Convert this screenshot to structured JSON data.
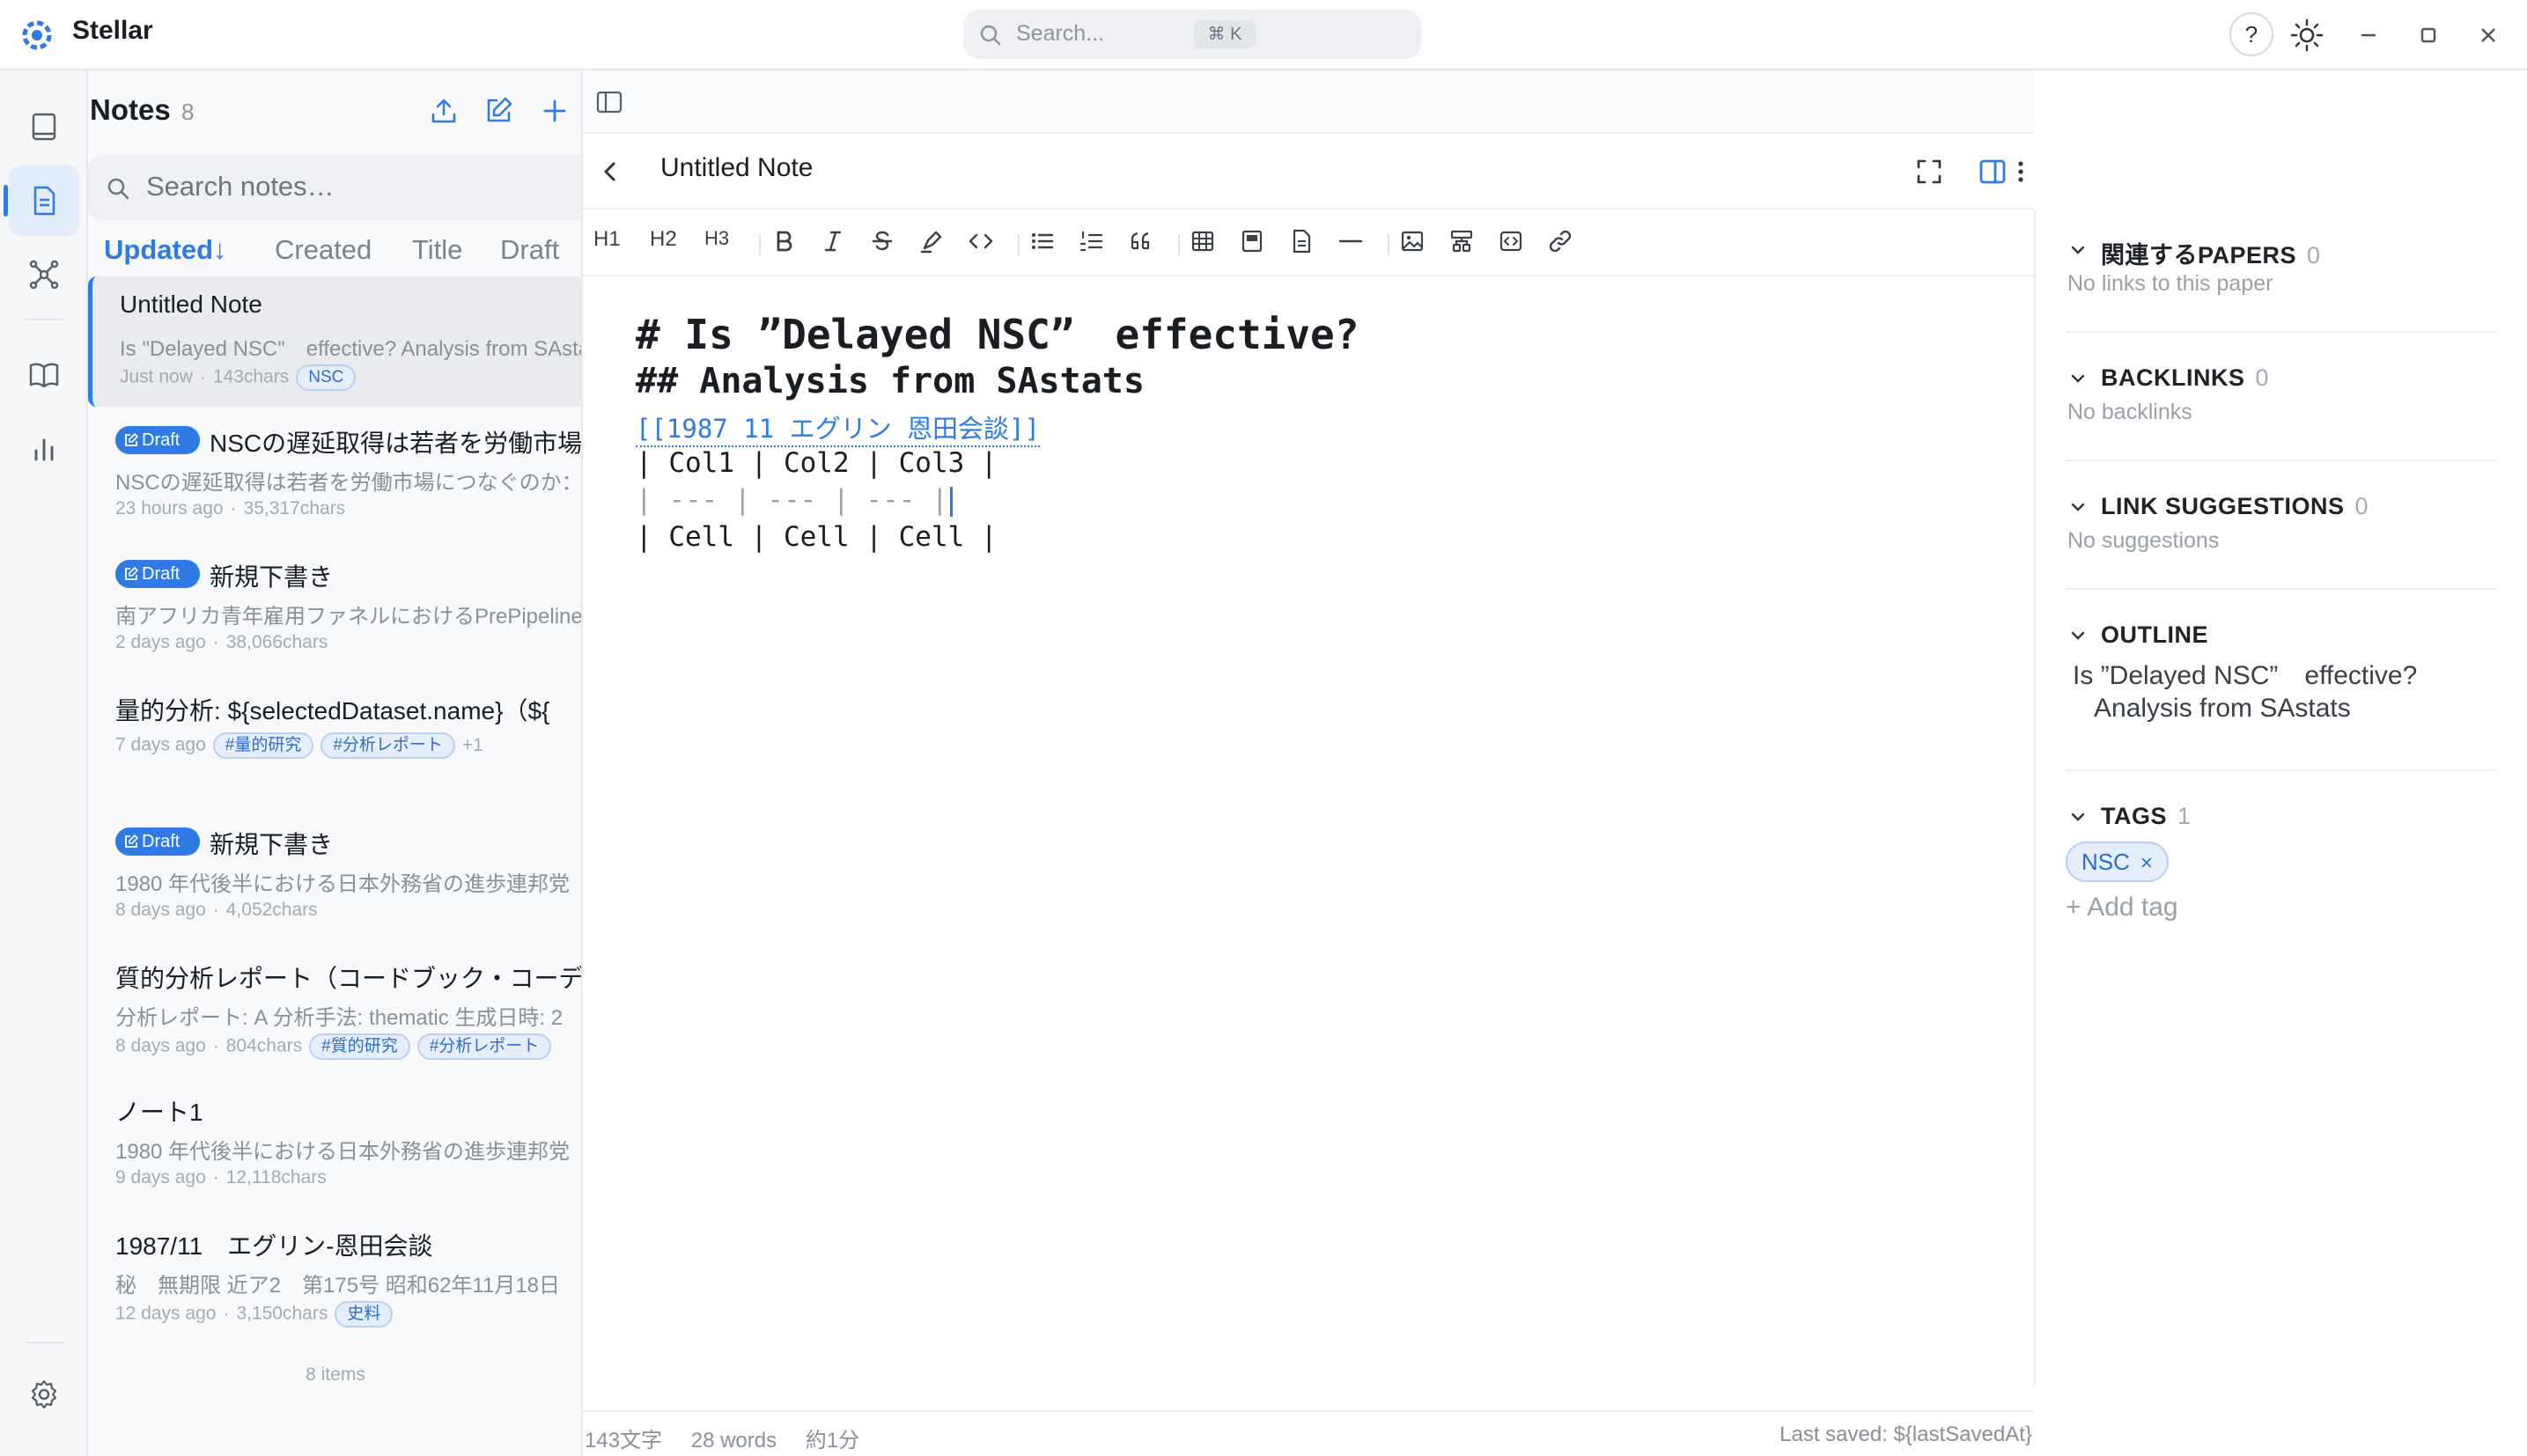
{
  "app": {
    "name": "Stellar",
    "search_placeholder": "Search...",
    "search_shortcut": "⌘ K",
    "help": "?"
  },
  "notes": {
    "title": "Notes",
    "count": "8",
    "search_placeholder": "Search notes…",
    "sort_tabs": [
      "Updated↓",
      "Created",
      "Title",
      "Draft"
    ],
    "items": [
      {
        "title": "Untitled Note",
        "draft": false,
        "preview": "Is \"Delayed NSC\"　effective? Analysis from SAstats",
        "time": "Just now",
        "chars": "143chars",
        "tags": [
          "NSC"
        ],
        "more": ""
      },
      {
        "title": "NSCの遅延取得は若者を労働市場につなぐのか",
        "draft": true,
        "preview": "NSCの遅延取得は若者を労働市場につなぐのか：",
        "time": "23 hours ago",
        "chars": "35,317chars",
        "tags": [],
        "more": ""
      },
      {
        "title": "新規下書き",
        "draft": true,
        "preview": "南アフリカ青年雇用ファネルにおけるPrePipeline",
        "time": "2 days ago",
        "chars": "38,066chars",
        "tags": [],
        "more": ""
      },
      {
        "title": "量的分析: ${selectedDataset.name}（${",
        "draft": false,
        "preview": "",
        "time": "7 days ago",
        "chars": "",
        "tags": [
          "#量的研究",
          "#分析レポート"
        ],
        "more": "+1"
      },
      {
        "title": "新規下書き",
        "draft": true,
        "preview": "1980 年代後半における日本外務省の進歩連邦党",
        "time": "8 days ago",
        "chars": "4,052chars",
        "tags": [],
        "more": ""
      },
      {
        "title": "質的分析レポート（コードブック・コーデ",
        "draft": false,
        "preview": "分析レポート: A 分析手法: thematic 生成日時: 2",
        "time": "8 days ago",
        "chars": "804chars",
        "tags": [
          "#質的研究",
          "#分析レポート"
        ],
        "more": ""
      },
      {
        "title": "ノート1",
        "draft": false,
        "preview": "1980 年代後半における日本外務省の進歩連邦党",
        "time": "9 days ago",
        "chars": "12,118chars",
        "tags": [],
        "more": ""
      },
      {
        "title": "1987/11　エグリン-恩田会談",
        "draft": false,
        "preview": "秘　無期限 近ア2　第175号 昭和62年11月18日",
        "time": "12 days ago",
        "chars": "3,150chars",
        "tags": [
          "史料"
        ],
        "more": ""
      }
    ],
    "draft_label": "Draft",
    "footer": "8 items"
  },
  "editor": {
    "note_title": "Untitled Note",
    "toolbar_text": [
      "H1",
      "H2",
      "H3"
    ],
    "content": {
      "h1": "# Is ”Delayed NSC”　effective?",
      "h2": "## Analysis from SAstats",
      "link": "[[1987 11 エグリン 恩田会談]]",
      "table": [
        "| Col1 | Col2 | Col3 |",
        "| --- | --- | --- |",
        "| Cell | Cell | Cell |"
      ]
    },
    "status": {
      "chars": "143文字",
      "words": "28 words",
      "read_time": "約1分",
      "last_saved": "Last saved: ${lastSavedAt}"
    }
  },
  "side_panel": {
    "related_papers": {
      "title": "関連するPAPERS",
      "count": "0",
      "empty": "No links to this paper"
    },
    "backlinks": {
      "title": "BACKLINKS",
      "count": "0",
      "empty": "No backlinks"
    },
    "link_suggestions": {
      "title": "LINK SUGGESTIONS",
      "count": "0",
      "empty": "No suggestions"
    },
    "outline": {
      "title": "OUTLINE",
      "items": [
        "Is ”Delayed NSC”　effective?",
        "Analysis from SAstats"
      ]
    },
    "tags": {
      "title": "TAGS",
      "count": "1",
      "items": [
        "NSC"
      ],
      "remove": "×",
      "add_tag": "+ Add tag"
    }
  },
  "colors": {
    "accent": "#2f7ae5",
    "chip_bg": "#e5eefc",
    "text_muted": "#8a9098"
  }
}
